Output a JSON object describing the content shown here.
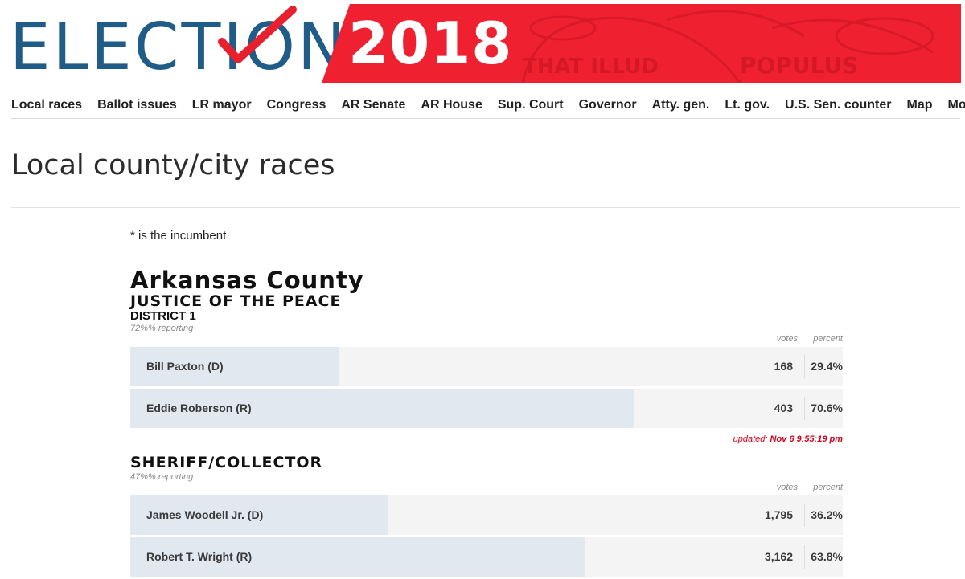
{
  "logo": {
    "word": "ELECTION",
    "year": "2018",
    "watermark": "THAT ILLUD POPULUS",
    "check_icon": "checkmark-icon",
    "colors": {
      "word": "#1f5d88",
      "check": "#e8202e",
      "banner": "#ef2131"
    }
  },
  "nav": [
    "Local races",
    "Ballot issues",
    "LR mayor",
    "Congress",
    "AR Senate",
    "AR House",
    "Sup. Court",
    "Governor",
    "Atty. gen.",
    "Lt. gov.",
    "U.S. Sen. counter",
    "Map",
    "More"
  ],
  "page": {
    "title": "Local county/city races",
    "note": "* is the incumbent"
  },
  "county": "Arkansas County",
  "races": [
    {
      "title": "JUSTICE OF THE PEACE",
      "subtitle": "DISTRICT 1",
      "reporting": "72%% reporting",
      "col_votes": "votes",
      "col_percent": "percent",
      "candidates": [
        {
          "name": "Bill Paxton (D)",
          "votes": "168",
          "percent": "29.4%",
          "share": 29.4
        },
        {
          "name": "Eddie Roberson (R)",
          "votes": "403",
          "percent": "70.6%",
          "share": 70.6
        }
      ],
      "updated_label": "updated:",
      "updated_time": "Nov 6 9:55:19 pm"
    },
    {
      "title": "SHERIFF/COLLECTOR",
      "subtitle": "",
      "reporting": "47%% reporting",
      "col_votes": "votes",
      "col_percent": "percent",
      "candidates": [
        {
          "name": "James Woodell Jr. (D)",
          "votes": "1,795",
          "percent": "36.2%",
          "share": 36.2
        },
        {
          "name": "Robert T. Wright (R)",
          "votes": "3,162",
          "percent": "63.8%",
          "share": 63.8
        }
      ]
    }
  ],
  "colors": {
    "bar": "#e1e8ef",
    "row": "#f4f4f4",
    "updated": "#d0021b"
  }
}
